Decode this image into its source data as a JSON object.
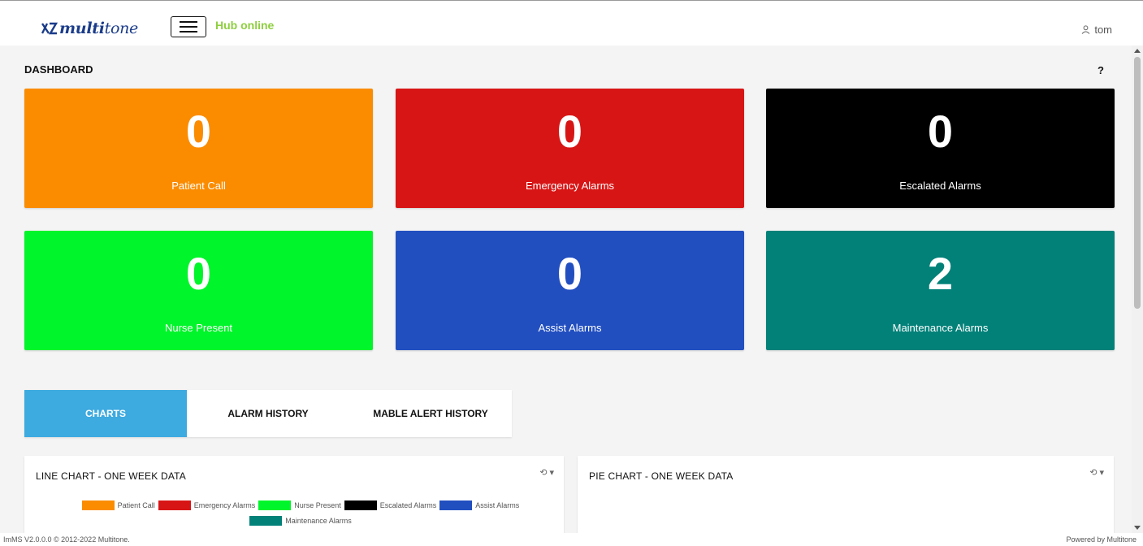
{
  "header": {
    "logo_prefix": "multi",
    "logo_suffix": "tone",
    "hub_status": "Hub online",
    "username": "tom",
    "colors": {
      "logo": "#1b3c8a",
      "hub_status": "#8ecf3f"
    }
  },
  "page": {
    "title": "DASHBOARD",
    "help": "?"
  },
  "tiles": [
    {
      "count": "0",
      "label": "Patient Call",
      "color": "#fb8c00"
    },
    {
      "count": "0",
      "label": "Emergency Alarms",
      "color": "#d81515"
    },
    {
      "count": "0",
      "label": "Escalated Alarms",
      "color": "#000000"
    },
    {
      "count": "0",
      "label": "Nurse Present",
      "color": "#00f52a"
    },
    {
      "count": "0",
      "label": "Assist Alarms",
      "color": "#224fc0"
    },
    {
      "count": "2",
      "label": "Maintenance Alarms",
      "color": "#028179"
    }
  ],
  "tabs": [
    {
      "label": "CHARTS",
      "active": true
    },
    {
      "label": "ALARM HISTORY",
      "active": false
    },
    {
      "label": "MABLE ALERT HISTORY",
      "active": false
    }
  ],
  "line_panel": {
    "title": "LINE CHART - ONE WEEK DATA",
    "menu": "⟲ ▾",
    "legend": [
      {
        "label": "Patient Call",
        "color": "#fb8c00"
      },
      {
        "label": "Emergency Alarms",
        "color": "#d81515"
      },
      {
        "label": "Nurse Present",
        "color": "#00f52a"
      },
      {
        "label": "Escalated Alarms",
        "color": "#000000"
      },
      {
        "label": "Assist Alarms",
        "color": "#224fc0"
      },
      {
        "label": "Maintenance Alarms",
        "color": "#028179"
      }
    ]
  },
  "pie_panel": {
    "title": "PIE CHART - ONE WEEK DATA",
    "menu": "⟲ ▾"
  },
  "footer": {
    "left": "ImMS V2.0.0.0 © 2012-2022 Multitone.",
    "right": "Powered by Multitone"
  }
}
